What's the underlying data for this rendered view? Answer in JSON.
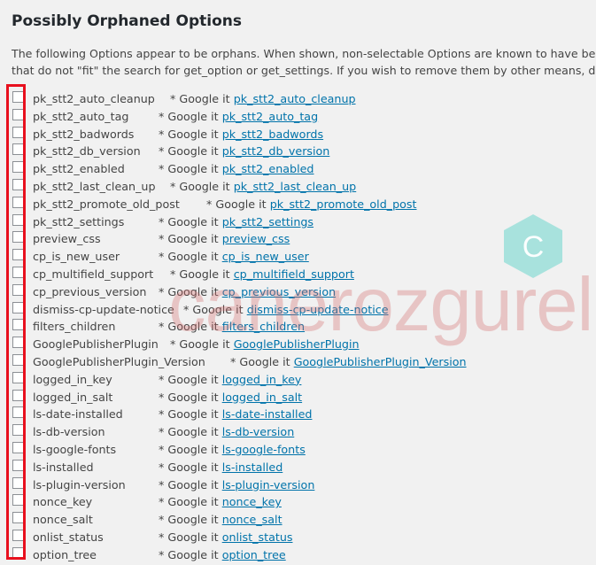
{
  "section": {
    "title": "Possibly Orphaned Options",
    "description_line1": "The following Options appear to be orphans. When shown, non-selectable Options are known to have been cr",
    "description_line2": "that do not \"fit\" the search for get_option or get_settings. If you wish to remove them by other means, do so a"
  },
  "google_it_text": "* Google it",
  "options": [
    {
      "name": "pk_stt2_auto_cleanup",
      "link": "pk_stt2_auto_cleanup",
      "checked": false
    },
    {
      "name": "pk_stt2_auto_tag",
      "link": "pk_stt2_auto_tag",
      "checked": false
    },
    {
      "name": "pk_stt2_badwords",
      "link": "pk_stt2_badwords",
      "checked": false
    },
    {
      "name": "pk_stt2_db_version",
      "link": "pk_stt2_db_version",
      "checked": false
    },
    {
      "name": "pk_stt2_enabled",
      "link": "pk_stt2_enabled",
      "checked": false
    },
    {
      "name": "pk_stt2_last_clean_up",
      "link": "pk_stt2_last_clean_up",
      "checked": false
    },
    {
      "name": "pk_stt2_promote_old_post",
      "link": "pk_stt2_promote_old_post",
      "checked": false
    },
    {
      "name": "pk_stt2_settings",
      "link": "pk_stt2_settings",
      "checked": false
    },
    {
      "name": "preview_css",
      "link": "preview_css",
      "checked": false
    },
    {
      "name": "cp_is_new_user",
      "link": "cp_is_new_user",
      "checked": false
    },
    {
      "name": "cp_multifield_support",
      "link": "cp_multifield_support",
      "checked": false
    },
    {
      "name": "cp_previous_version",
      "link": "cp_previous_version",
      "checked": false
    },
    {
      "name": "dismiss-cp-update-notice",
      "link": "dismiss-cp-update-notice",
      "checked": false
    },
    {
      "name": "filters_children",
      "link": "filters_children",
      "checked": false
    },
    {
      "name": "GooglePublisherPlugin",
      "link": "GooglePublisherPlugin",
      "checked": false
    },
    {
      "name": "GooglePublisherPlugin_Version",
      "link": "GooglePublisherPlugin_Version",
      "checked": false
    },
    {
      "name": "logged_in_key",
      "link": "logged_in_key",
      "checked": false
    },
    {
      "name": "logged_in_salt",
      "link": "logged_in_salt",
      "checked": false
    },
    {
      "name": "ls-date-installed",
      "link": "ls-date-installed",
      "checked": false
    },
    {
      "name": "ls-db-version",
      "link": "ls-db-version",
      "checked": false
    },
    {
      "name": "ls-google-fonts",
      "link": "ls-google-fonts",
      "checked": false
    },
    {
      "name": "ls-installed",
      "link": "ls-installed",
      "checked": false
    },
    {
      "name": "ls-plugin-version",
      "link": "ls-plugin-version",
      "checked": false
    },
    {
      "name": "nonce_key",
      "link": "nonce_key",
      "checked": false
    },
    {
      "name": "nonce_salt",
      "link": "nonce_salt",
      "checked": false
    },
    {
      "name": "onlist_status",
      "link": "onlist_status",
      "checked": false
    },
    {
      "name": "option_tree",
      "link": "option_tree",
      "checked": false
    }
  ],
  "watermark": {
    "text": "canerozgurel.com",
    "logo_letter": "C",
    "text_color": "#d66969",
    "logo_color": "#4fd1c5"
  },
  "colors": {
    "link": "#0073aa",
    "highlight_border": "#e8101e",
    "background": "#f1f1f1"
  }
}
